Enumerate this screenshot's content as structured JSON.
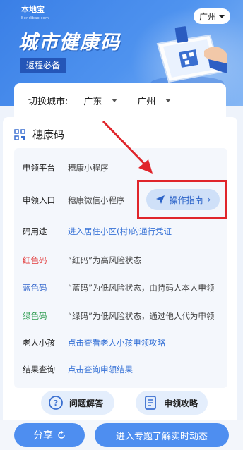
{
  "banner": {
    "logo": "本地宝",
    "logo_sub": "Bendibao.com",
    "city": "广州",
    "title": "城市健康码",
    "tag": "返程必备"
  },
  "selector": {
    "label": "切换城市:",
    "province": "广东",
    "city": "广州"
  },
  "section": {
    "title": "穗康码"
  },
  "rows": [
    {
      "key": "申领平台",
      "value": "穗康小程序"
    },
    {
      "key": "申领入口",
      "value": "穗康微信小程序"
    },
    {
      "key": "码用途",
      "value": "进入居住小区(村)的通行凭证"
    },
    {
      "key": "红色码",
      "value": "“红码”为高风险状态"
    },
    {
      "key": "蓝色码",
      "value": "“蓝码”为低风险状态，由持码人本人申领"
    },
    {
      "key": "绿色码",
      "value": "“绿码”为低风险状态，通过他人代为申领"
    },
    {
      "key": "老人小孩",
      "value": "点击查看老人小孩申领攻略"
    },
    {
      "key": "结果查询",
      "value": "点击查询申领结果"
    }
  ],
  "guide_button": "操作指南",
  "chips": {
    "faq": "问题解答",
    "guide": "申领攻略"
  },
  "bottom": {
    "share": "分享",
    "topic": "进入专题了解实时动态"
  },
  "colors": {
    "accent": "#4e8ef0",
    "highlight": "#e0252b"
  }
}
